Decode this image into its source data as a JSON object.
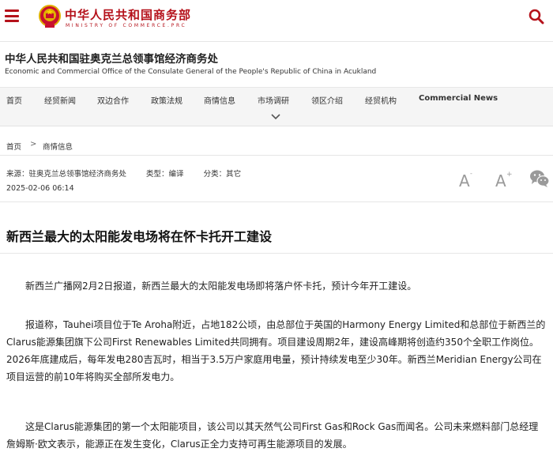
{
  "header": {
    "logo_cn": "中华人民共和国商务部",
    "logo_en": "MINISTRY OF COMMERCE.PRC"
  },
  "office": {
    "title_cn": "中华人民共和国驻奥克兰总领事馆经济商务处",
    "title_en": "Economic and Commercial Office of the Consulate General of the People's Republic of China in Acukland"
  },
  "nav": {
    "items": [
      {
        "label": "首页"
      },
      {
        "label": "经贸新闻"
      },
      {
        "label": "双边合作"
      },
      {
        "label": "政策法规"
      },
      {
        "label": "商情信息"
      },
      {
        "label": "市场调研"
      },
      {
        "label": "领区介绍"
      },
      {
        "label": "经贸机构"
      },
      {
        "label": "Commercial News"
      }
    ]
  },
  "breadcrumb": {
    "home": "首页",
    "separator": ">",
    "current": "商情信息"
  },
  "meta": {
    "source": "来源：驻奥克兰总领事馆经济商务处",
    "type": "类型：编译",
    "category": "分类：其它",
    "date": "2025-02-06 06:14"
  },
  "article": {
    "title": "新西兰最大的太阳能发电场将在怀卡托开工建设",
    "paragraphs": [
      "新西兰广播网2月2日报道，新西兰最大的太阳能发电场即将落户怀卡托，预计今年开工建设。",
      "报道称，Tauhei项目位于Te Aroha附近，占地182公顷，由总部位于英国的Harmony Energy Limited和总部位于新西兰的Clarus能源集团旗下公司First Renewables Limited共同拥有。项目建设周期2年，建设高峰期将创造约350个全职工作岗位。2026年底建成后，每年发电280吉瓦时，相当于3.5万户家庭用电量，预计持续发电至少30年。新西兰Meridian Energy公司在项目运营的前10年将购买全部所发电力。",
      "这是Clarus能源集团的第一个太阳能项目，该公司以其天然气公司First Gas和Rock Gas而闻名。公司未来燃料部门总经理詹姆斯·欧文表示，能源正在发生变化，Clarus正全力支持可再生能源项目的发展。"
    ]
  },
  "colors": {
    "brand_red": "#b5121b",
    "nav_bg": "#f5f5f5",
    "icon_gray": "#9a9a9a"
  },
  "icons": {
    "menu": "hamburger-menu-icon",
    "emblem": "national-emblem-icon",
    "search": "search-icon",
    "font_increase": "font-increase-icon",
    "wechat": "wechat-icon",
    "chevron": "chevron-down-icon"
  }
}
